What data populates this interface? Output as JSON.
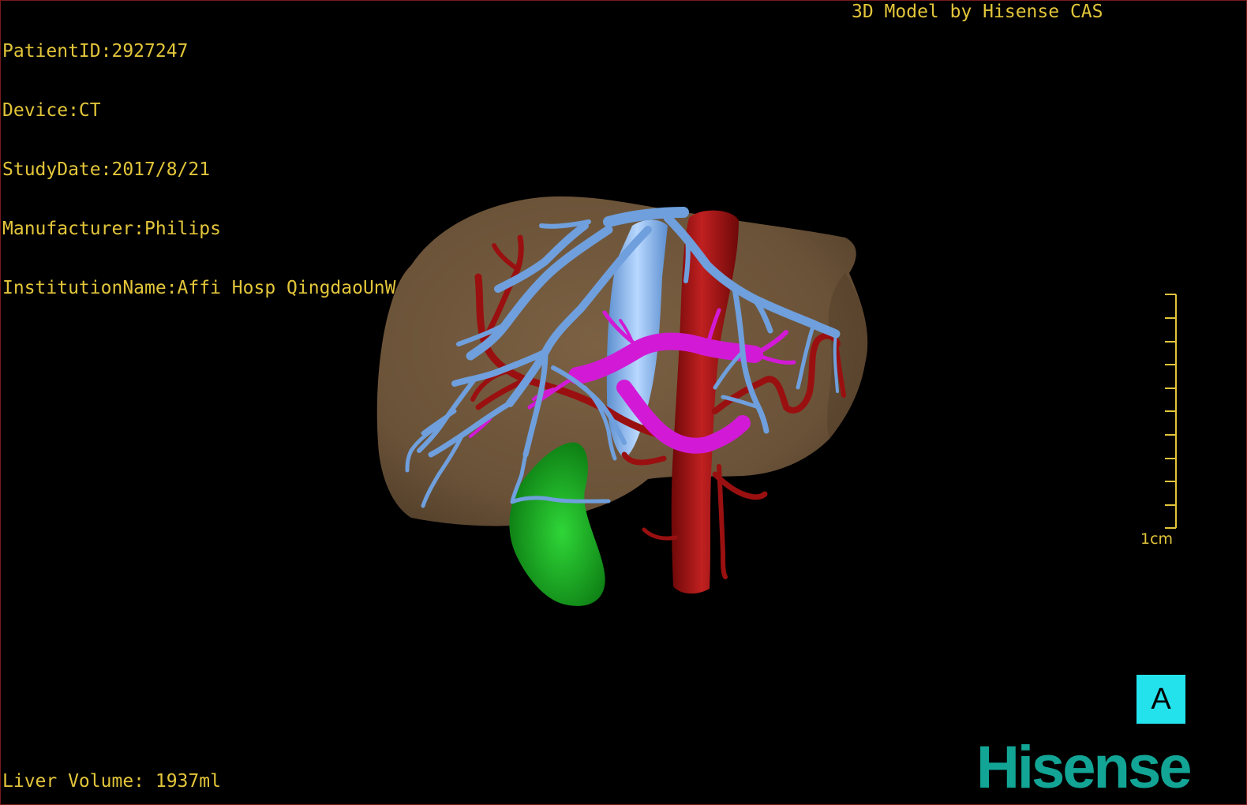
{
  "header": {
    "patient_id": "PatientID:2927247",
    "device": "Device:CT",
    "study_date": "StudyDate:2017/8/21",
    "manufacturer": "Manufacturer:Philips",
    "institution": "InstitutionName:Affi Hosp QingdaoUnW"
  },
  "credit": "3D Model by Hisense CAS",
  "footer": {
    "liver_volume": "Liver Volume: 1937ml"
  },
  "scale_bar": {
    "label": "1cm"
  },
  "orientation": {
    "label": "A"
  },
  "brand": {
    "logo_text": "Hisense"
  },
  "colors": {
    "overlay_text": "#e2c53a",
    "liver": "#6b5239",
    "hepatic_vein": "#6f9fdc",
    "ivc": "#8fbff0",
    "artery": "#9a1010",
    "portal_vein": "#d21ad6",
    "gallbladder": "#18a020",
    "orientation_cube": "#23e2ec",
    "brand": "#12a596"
  },
  "icons": {
    "orientation_marker": "anterior-view-cube",
    "brand_logo": "hisense-logo"
  }
}
